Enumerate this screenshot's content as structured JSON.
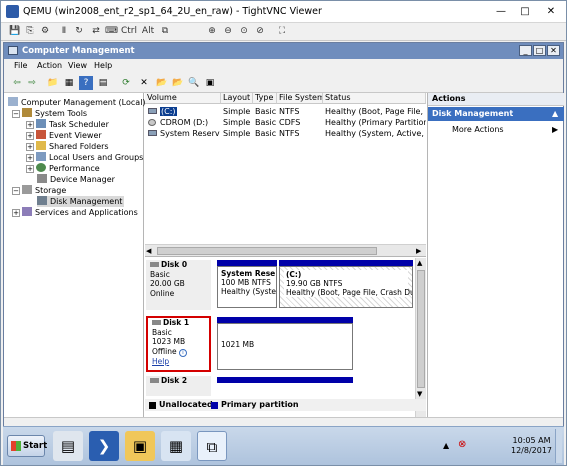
{
  "viewer": {
    "title": "QEMU (win2008_ent_r2_sp1_64_2U_en_raw) - TightVNC Viewer",
    "min": "—",
    "max": "□",
    "close": "✕",
    "toolbar": [
      "💾",
      "⎘",
      "⚙",
      "Ⅱ",
      "↻",
      "⇄",
      "⌨",
      "Ctrl",
      "Alt",
      "⧉",
      "⊕",
      "⊖",
      "⊙",
      "⊘",
      "⛶"
    ]
  },
  "window": {
    "title": "Computer Management",
    "min": "_",
    "max": "□",
    "close": "✕"
  },
  "menu": [
    "File",
    "Action",
    "View",
    "Help"
  ],
  "toolbar": [
    "⇦",
    "⇨",
    "📁",
    "▦",
    "?",
    "▤",
    "⟳",
    "✕",
    "📂",
    "📂",
    "🔍",
    "▣"
  ],
  "tree": {
    "root": "Computer Management (Local)",
    "system_tools": "System Tools",
    "task_scheduler": "Task Scheduler",
    "event_viewer": "Event Viewer",
    "shared_folders": "Shared Folders",
    "local_users": "Local Users and Groups",
    "performance": "Performance",
    "device_manager": "Device Manager",
    "storage": "Storage",
    "disk_management": "Disk Management",
    "services": "Services and Applications"
  },
  "volumes": {
    "headers": [
      "Volume",
      "Layout",
      "Type",
      "File System",
      "Status"
    ],
    "rows": [
      [
        "(C:)",
        "Simple",
        "Basic",
        "NTFS",
        "Healthy (Boot, Page File, Cras"
      ],
      [
        "CDROM (D:)",
        "Simple",
        "Basic",
        "CDFS",
        "Healthy (Primary Partition)"
      ],
      [
        "System Reserved",
        "Simple",
        "Basic",
        "NTFS",
        "Healthy (System, Active, Prim"
      ]
    ]
  },
  "disks": {
    "disk0": {
      "name": "Disk 0",
      "type": "Basic",
      "size": "20.00 GB",
      "status": "Online",
      "p1": {
        "name": "System Rese",
        "size": "100 MB NTFS",
        "status": "Healthy (Syster"
      },
      "p2": {
        "name": "(C:)",
        "size": "19.90 GB NTFS",
        "status": "Healthy (Boot, Page File, Crash Dump"
      }
    },
    "disk1": {
      "name": "Disk 1",
      "type": "Basic",
      "size": "1023 MB",
      "status": "Offline",
      "help": "Help",
      "p1": {
        "size": "1021 MB"
      }
    },
    "disk2": {
      "name": "Disk 2"
    }
  },
  "legend": {
    "unallocated": "Unallocated",
    "primary": "Primary partition"
  },
  "actions": {
    "header": "Actions",
    "selected": "Disk Management",
    "more": "More Actions"
  },
  "taskbar": {
    "start": "Start",
    "time": "10:05 AM",
    "date": "12/8/2017"
  },
  "colors": {
    "partition_bar": "#0000a8",
    "selection_box": "#d40000",
    "actions_selected": "#3a6fc0"
  }
}
